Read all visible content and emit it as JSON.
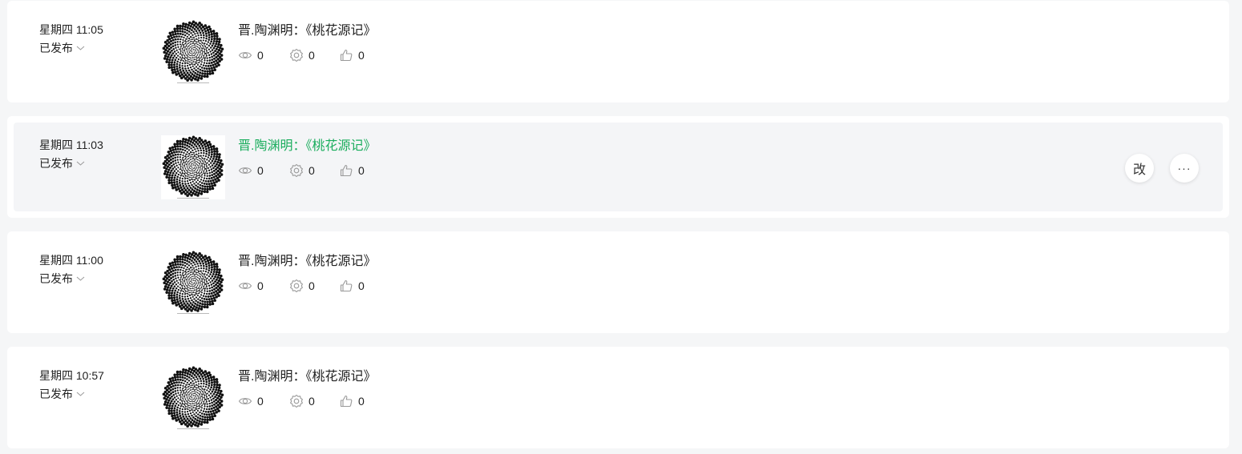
{
  "posts": [
    {
      "time": "星期四 11:05",
      "status": "已发布",
      "title": "晋.陶渊明：《桃花源记》",
      "views": "0",
      "shares": "0",
      "likes": "0"
    },
    {
      "time": "星期四 11:03",
      "status": "已发布",
      "title": "晋.陶渊明：《桃花源记》",
      "views": "0",
      "shares": "0",
      "likes": "0",
      "edit_label": "改",
      "more_label": "···"
    },
    {
      "time": "星期四 11:00",
      "status": "已发布",
      "title": "晋.陶渊明：《桃花源记》",
      "views": "0",
      "shares": "0",
      "likes": "0"
    },
    {
      "time": "星期四 10:57",
      "status": "已发布",
      "title": "晋.陶渊明：《桃花源记》",
      "views": "0",
      "shares": "0",
      "likes": "0"
    }
  ],
  "colors": {
    "accent": "#1aad5d",
    "background": "#f5f6f7",
    "card": "#ffffff",
    "hover_card": "#f4f5f7"
  },
  "icons": {
    "views": "eye-icon",
    "shares": "gear-share-icon",
    "likes": "thumbs-up-icon",
    "status_dropdown": "chevron-down-icon",
    "thumbnail": "spiral-image"
  }
}
